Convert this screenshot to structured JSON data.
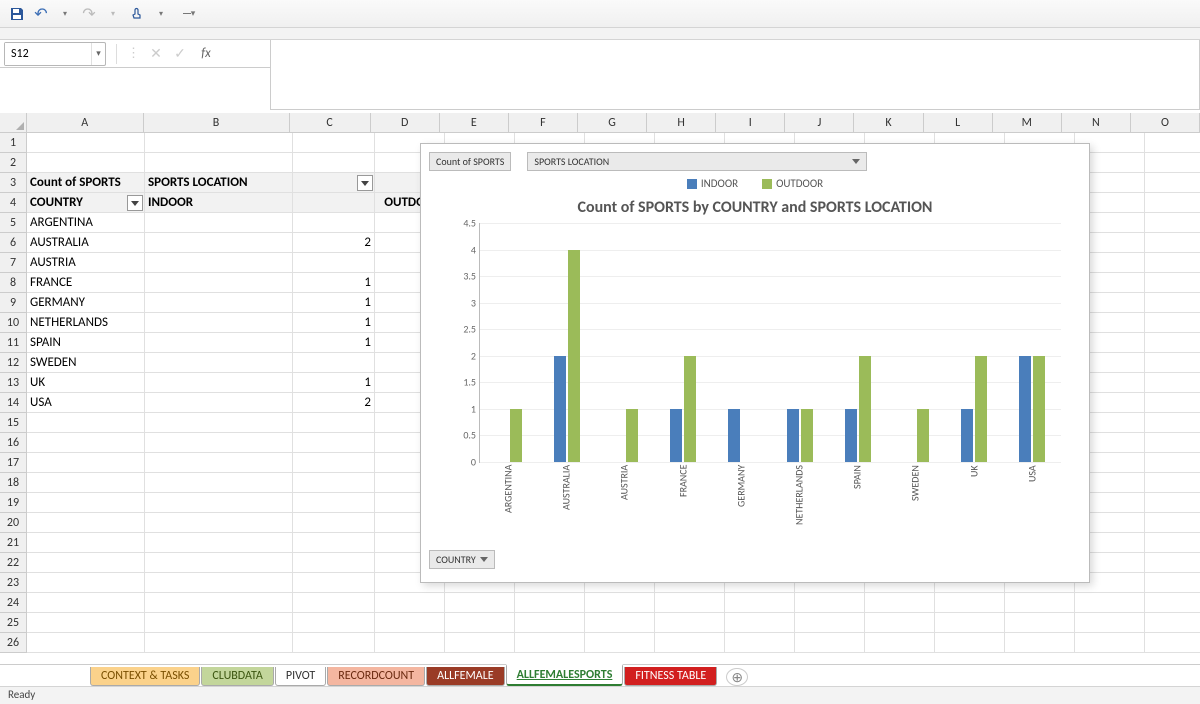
{
  "namebox": "S12",
  "status": "Ready",
  "colWidths": {
    "A": 118,
    "B": 148,
    "C": 82,
    "D": 70,
    "E": 70,
    "F": 70,
    "G": 70,
    "H": 70,
    "I": 70,
    "J": 70,
    "K": 70,
    "L": 70,
    "M": 70,
    "N": 70,
    "O": 70
  },
  "rowCount": 26,
  "pivot": {
    "count_label": "Count of SPORTS",
    "field_label": "SPORTS LOCATION",
    "row_field": "COUNTRY",
    "cols": [
      "INDOOR",
      "OUTDOOR"
    ],
    "rows": [
      {
        "c": "ARGENTINA",
        "in": null,
        "out": 1
      },
      {
        "c": "AUSTRALIA",
        "in": 2,
        "out": 4
      },
      {
        "c": "AUSTRIA",
        "in": null,
        "out": 1
      },
      {
        "c": "FRANCE",
        "in": 1,
        "out": 2
      },
      {
        "c": "GERMANY",
        "in": 1,
        "out": null
      },
      {
        "c": "NETHERLANDS",
        "in": 1,
        "out": 1
      },
      {
        "c": "SPAIN",
        "in": 1,
        "out": 2
      },
      {
        "c": "SWEDEN",
        "in": null,
        "out": 1
      },
      {
        "c": "UK",
        "in": 1,
        "out": 2
      },
      {
        "c": "USA",
        "in": 2,
        "out": 2
      }
    ]
  },
  "chart": {
    "btn_count": "Count of SPORTS",
    "btn_loc": "SPORTS LOCATION",
    "btn_country": "COUNTRY",
    "legend": [
      "INDOOR",
      "OUTDOOR"
    ],
    "title": "Count of SPORTS by COUNTRY and SPORTS LOCATION",
    "series_colors": {
      "INDOOR": "#4a7ebb",
      "OUTDOOR": "#9bbb59"
    }
  },
  "chart_data": {
    "type": "bar",
    "title": "Count of SPORTS by COUNTRY and SPORTS LOCATION",
    "xlabel": "",
    "ylabel": "",
    "ylim": [
      0,
      4.5
    ],
    "yticks": [
      0,
      0.5,
      1,
      1.5,
      2,
      2.5,
      3,
      3.5,
      4,
      4.5
    ],
    "categories": [
      "ARGENTINA",
      "AUSTRALIA",
      "AUSTRIA",
      "FRANCE",
      "GERMANY",
      "NETHERLANDS",
      "SPAIN",
      "SWEDEN",
      "UK",
      "USA"
    ],
    "series": [
      {
        "name": "INDOOR",
        "values": [
          0,
          2,
          0,
          1,
          1,
          1,
          1,
          0,
          1,
          2
        ]
      },
      {
        "name": "OUTDOOR",
        "values": [
          1,
          4,
          1,
          2,
          0,
          1,
          2,
          1,
          2,
          2
        ]
      }
    ]
  },
  "tabs": [
    {
      "label": "CONTEXT & TASKS",
      "bg": "#fbd28b",
      "fg": "#7a4f00"
    },
    {
      "label": "CLUBDATA",
      "bg": "#c3d69b",
      "fg": "#3c5610"
    },
    {
      "label": "PIVOT",
      "bg": "#ffffff",
      "fg": "#333"
    },
    {
      "label": "RECORDCOUNT",
      "bg": "#f4b6a0",
      "fg": "#6b2a10"
    },
    {
      "label": "ALLFEMALE",
      "bg": "#9a3b26",
      "fg": "#fff"
    },
    {
      "label": "ALLFEMALESPORTS",
      "bg": "#ffffff",
      "fg": "#2e7d32",
      "active": true
    },
    {
      "label": "FITNESS TABLE",
      "bg": "#d21f1f",
      "fg": "#fff"
    }
  ]
}
